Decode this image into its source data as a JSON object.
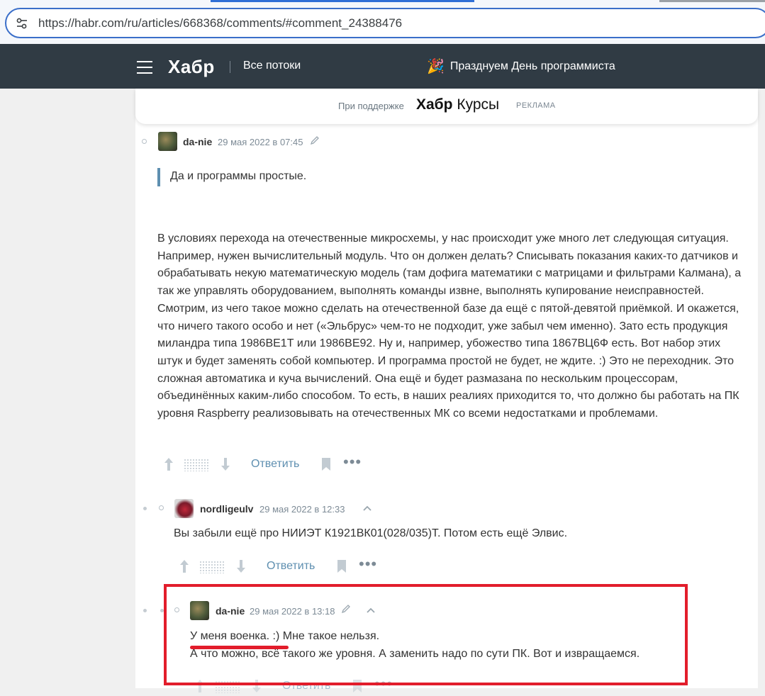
{
  "browser": {
    "url": "https://habr.com/ru/articles/668368/comments/#comment_24388476"
  },
  "header": {
    "logo": "Хабр",
    "all_flows": "Все потоки",
    "holiday_text": "Празднуем День программиста",
    "holiday_emoji": "🎉"
  },
  "sponsor": {
    "label": "При поддержке",
    "brand_bold": "Хабр",
    "brand_rest": "Курсы",
    "ad_label": "РЕКЛАМА"
  },
  "comments": [
    {
      "author": "da-nie",
      "time": "29 мая 2022 в 07:45",
      "quote": "Да и программы простые.",
      "text": "В условиях перехода на отечественные микросхемы, у нас происходит уже много лет следующая ситуация. Например, нужен вычислительный модуль. Что он должен делать? Списывать показания каких-то датчиков и обрабатывать некую математическую модель (там дофига математики с матрицами и фильтрами Калмана), а так же управлять оборудованием, выполнять команды извне, выполнять купирование неисправностей. Смотрим, из чего такое можно сделать на отечественной базе да ещё с пятой-девятой приёмкой. И окажется, что ничего такого особо и нет («Эльбрус» чем-то не подходит, уже забыл чем именно). Зато есть продукция миландра типа 1986ВЕ1Т или 1986ВЕ92. Ну и, например, убожество типа 1867ВЦ6Ф есть. Вот набор этих штук и будет заменять собой компьютер. И программа простой не будет, не ждите. :) Это не переходник. Это сложная автоматика и куча вычислений. Она ещё и будет размазана по нескольким процессорам, объединённых каким-либо способом. То есть, в наших реалиях приходится то, что должно бы работать на ПК уровня Raspberry реализовывать на отечественных МК со всеми недостатками и проблемами.",
      "reply_label": "Ответить"
    },
    {
      "author": "nordligeulv",
      "time": "29 мая 2022 в 12:33",
      "text": "Вы забыли ещё про НИИЭТ К1921ВК01(028/035)Т. Потом есть ещё Элвис.",
      "reply_label": "Ответить"
    },
    {
      "author": "da-nie",
      "time": "29 мая 2022 в 13:18",
      "line1": "У меня военка. :) Мне такое нельзя.",
      "line2": "А что можно, всё такого же уровня. А заменить надо по сути ПК. Вот и извращаемся.",
      "reply_label": "Ответить"
    }
  ],
  "colors": {
    "header_bg": "#303b44",
    "link": "#5e8fb0",
    "highlight": "#e21d2b"
  }
}
